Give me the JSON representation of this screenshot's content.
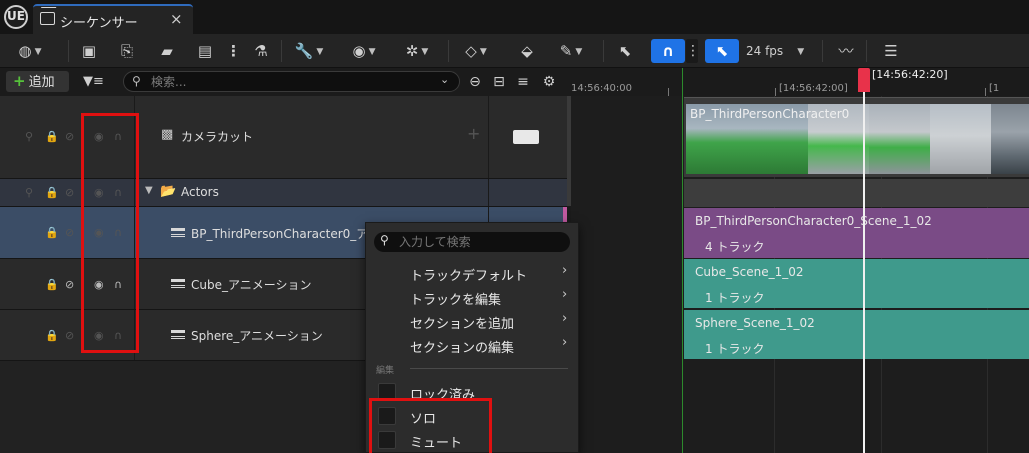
{
  "window": {
    "logo": "UE",
    "tab_title": "シーケンサー",
    "tab_close": "×"
  },
  "toolbar": {
    "fps_label": "24 fps",
    "snap_icon": "magnet-icon",
    "accent_color": "#1f73e6"
  },
  "outliner": {
    "add_label": "追加",
    "search_placeholder": "検索..."
  },
  "ruler": {
    "labels": [
      "14:56:40:00",
      "[14:56:42:00]",
      "[1"
    ],
    "playhead_label": "[14:56:42:20]"
  },
  "tracks": {
    "camera": {
      "name": "カメラカット",
      "plus": "+"
    },
    "actors": {
      "name": "Actors"
    },
    "bp": {
      "name": "BP_ThirdPersonCharacter0_アニ"
    },
    "cube": {
      "name": "Cube_アニメーション"
    },
    "sphere": {
      "name": "Sphere_アニメーション"
    }
  },
  "sections": {
    "camera": {
      "label": "BP_ThirdPersonCharacter0"
    },
    "bp": {
      "title": "BP_ThirdPersonCharacter0_Scene_1_02",
      "count": "4 トラック",
      "color": "#7a4b86"
    },
    "cube": {
      "title": "Cube_Scene_1_02",
      "count": "1 トラック",
      "color": "#3f9a8c"
    },
    "sphere": {
      "title": "Sphere_Scene_1_02",
      "count": "1 トラック",
      "color": "#3f9a8c"
    }
  },
  "context_menu": {
    "search_placeholder": "入力して検索",
    "items": [
      {
        "label": "トラックデフォルト",
        "arrow": "›"
      },
      {
        "label": "トラックを編集",
        "arrow": "›"
      },
      {
        "label": "セクションを追加",
        "arrow": "›"
      },
      {
        "label": "セクションの編集",
        "arrow": "›"
      }
    ],
    "section_label": "編集",
    "checks": [
      {
        "label": "ロック済み",
        "checked": false
      },
      {
        "label": "ソロ",
        "checked": false
      },
      {
        "label": "ミュート",
        "checked": false
      }
    ]
  }
}
